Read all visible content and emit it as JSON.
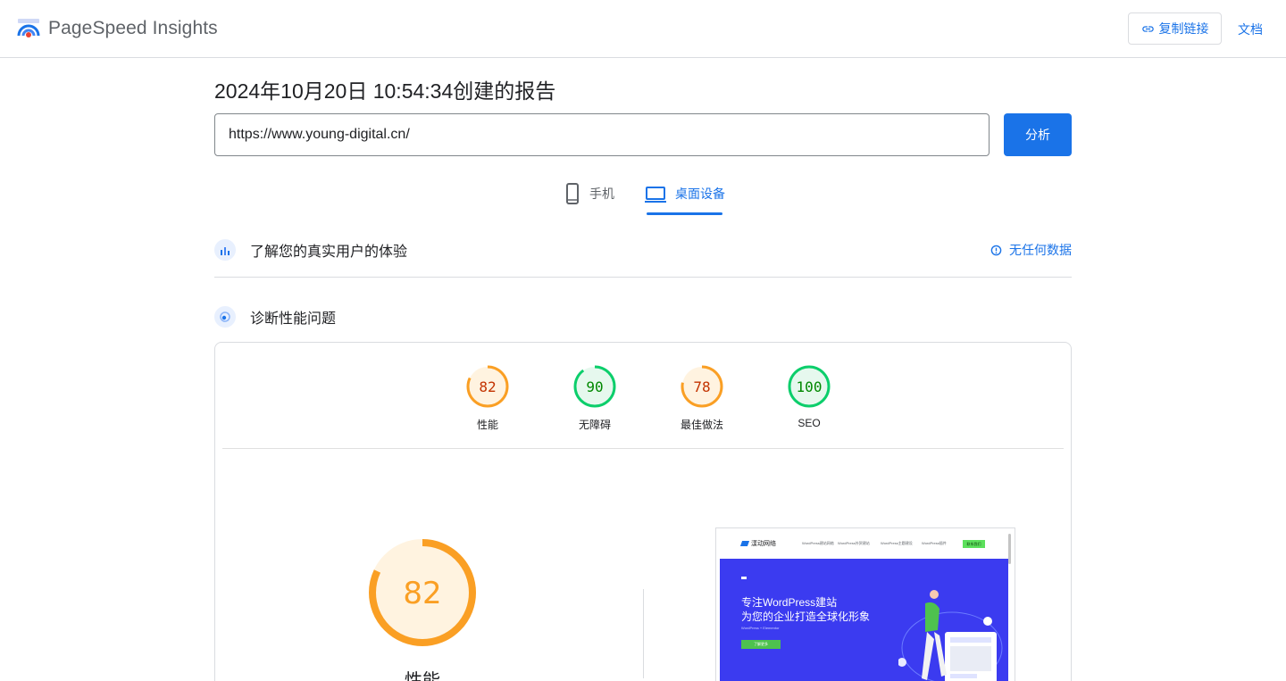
{
  "header": {
    "brand": "PageSpeed Insights",
    "copy_link": "复制链接",
    "docs": "文档"
  },
  "report": {
    "title": "2024年10月20日 10:54:34创建的报告",
    "url_value": "https://www.young-digital.cn/",
    "analyze_label": "分析"
  },
  "tabs": {
    "mobile": "手机",
    "desktop": "桌面设备",
    "active": "desktop"
  },
  "crux": {
    "title": "了解您的真实用户的体验",
    "no_data": "无任何数据"
  },
  "diagnose": {
    "title": "诊断性能问题"
  },
  "scores": [
    {
      "label": "性能",
      "value": "82",
      "color": "#fa9f24",
      "ring": "#fbbd5c",
      "text": "#c33300",
      "fill": "#fff3e0"
    },
    {
      "label": "无障碍",
      "value": "90",
      "color": "#0cce6b",
      "ring": "#0cce6b",
      "text": "#008800",
      "fill": "#e6f8ee"
    },
    {
      "label": "最佳做法",
      "value": "78",
      "color": "#fa9f24",
      "ring": "#fbbd5c",
      "text": "#c33300",
      "fill": "#fff3e0"
    },
    {
      "label": "SEO",
      "value": "100",
      "color": "#0cce6b",
      "ring": "#0cce6b",
      "text": "#008800",
      "fill": "#e6f8ee"
    }
  ],
  "performance": {
    "score": "82",
    "label": "性能"
  },
  "screenshot": {
    "logo_text": "漾动网络",
    "nav_items": [
      "WordPress建站网络",
      "WordPress外贸建站",
      "WordPress主题建设",
      "WordPress插件"
    ],
    "cta": "联系我们",
    "headline_1": "专注WordPress建站",
    "headline_2": "为您的企业打造全球化形象",
    "small_text": "WordPress + Elementor",
    "button": "了解更多"
  },
  "colors": {
    "accent": "#1a73e8",
    "average": "#fa9f24",
    "pass": "#0cce6b"
  }
}
